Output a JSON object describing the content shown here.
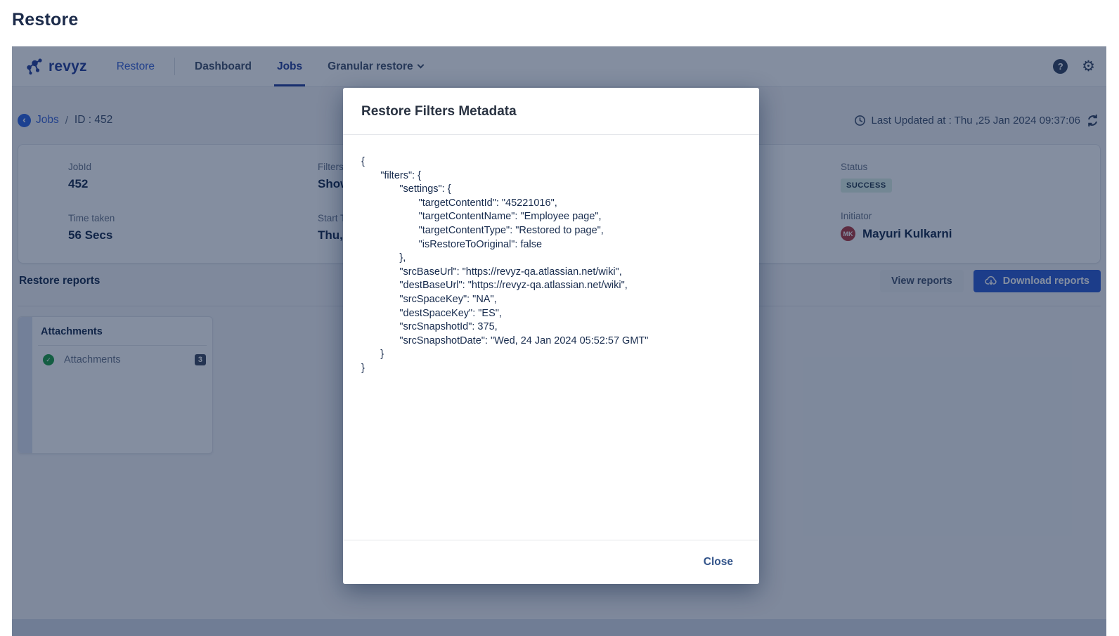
{
  "page": {
    "title": "Restore"
  },
  "nav": {
    "brand": "revyz",
    "items": [
      {
        "label": "Restore"
      },
      {
        "label": "Dashboard"
      },
      {
        "label": "Jobs",
        "active": true
      },
      {
        "label": "Granular restore"
      }
    ]
  },
  "breadcrumb": {
    "back_label": "‹",
    "jobs_link": "Jobs",
    "separator": "/",
    "id_label": "ID : 452"
  },
  "last_updated": {
    "text": "Last Updated at : Thu ,25 Jan 2024 09:37:06"
  },
  "job": {
    "jobid_label": "JobId",
    "jobid_value": "452",
    "time_label": "Time taken",
    "time_value": "56 Secs",
    "filters_label": "Filters",
    "filters_value": "Show",
    "start_label": "Start T",
    "start_value": "Thu,",
    "status_label": "Status",
    "status_value": "SUCCESS",
    "initiator_label": "Initiator",
    "initiator_value": "Mayuri Kulkarni",
    "initiator_initials": "MK"
  },
  "reports": {
    "heading": "Restore reports",
    "view_button": "View reports",
    "download_button": "Download reports"
  },
  "attachments_card": {
    "title": "Attachments",
    "item_label": "Attachments",
    "item_status": "success",
    "count": "3"
  },
  "modal": {
    "title": "Restore Filters Metadata",
    "close_button": "Close",
    "json_lines": [
      "{",
      "    \"filters\": {",
      "        \"settings\": {",
      "            \"targetContentId\": \"45221016\",",
      "            \"targetContentName\": \"Employee page\",",
      "            \"targetContentType\": \"Restored to page\",",
      "            \"isRestoreToOriginal\": false",
      "        },",
      "        \"srcBaseUrl\": \"https://revyz-qa.atlassian.net/wiki\",",
      "        \"destBaseUrl\": \"https://revyz-qa.atlassian.net/wiki\",",
      "        \"srcSpaceKey\": \"NA\",",
      "        \"destSpaceKey\": \"ES\",",
      "        \"srcSnapshotId\": 375,",
      "        \"srcSnapshotDate\": \"Wed, 24 Jan 2024 05:52:57 GMT\"",
      "    }",
      "}"
    ]
  },
  "icons": {
    "help": "help-icon (?)",
    "settings": "gear-icon ⚙",
    "back": "chevron-left-icon",
    "clock": "clock-icon",
    "refresh": "refresh-icon",
    "download": "cloud-download-icon",
    "success_check": "check-circle-icon",
    "granular_dropdown": "chevron-down-icon"
  },
  "colors": {
    "brand_blue": "#27409b",
    "link_blue": "#3e66d6",
    "primary_button": "#2f5dd3",
    "success_badge_bg": "#ddf0e7",
    "avatar_bg": "#b13a41",
    "content_bg": "#f4f5f7",
    "overlay": "rgba(9,30,66,0.5)"
  }
}
